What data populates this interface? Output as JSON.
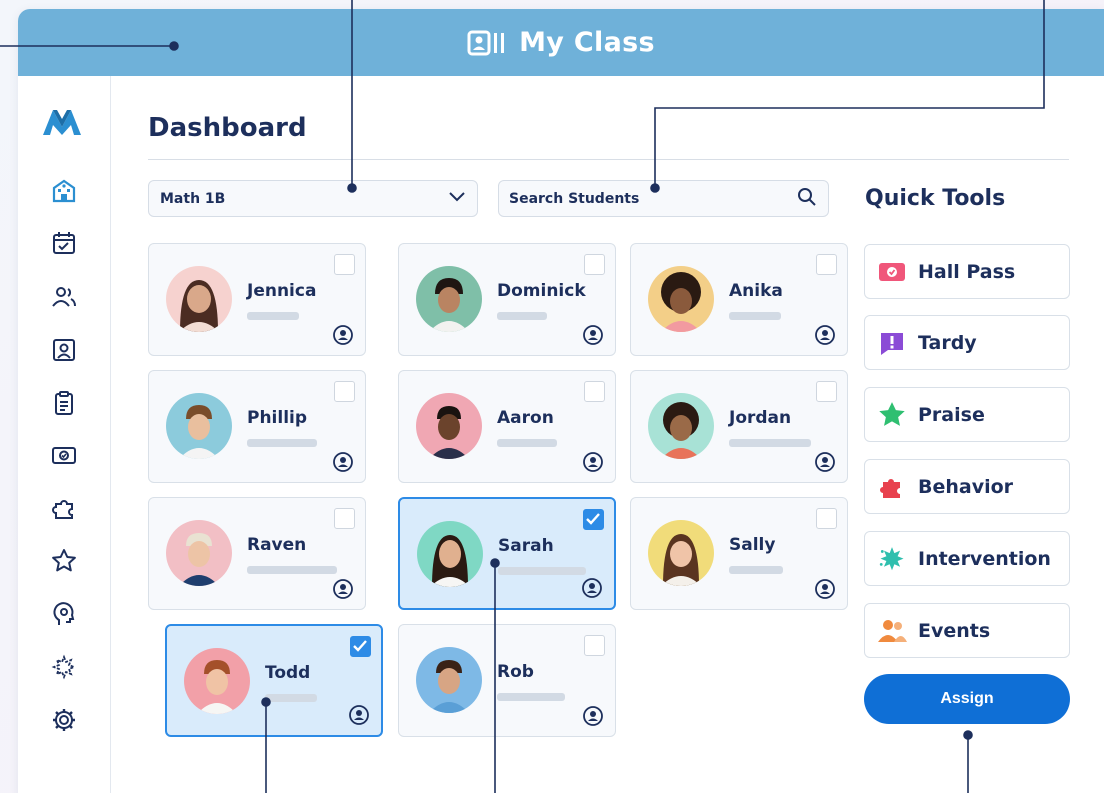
{
  "window": {
    "title": "My Class"
  },
  "page": {
    "title": "Dashboard"
  },
  "class_select": {
    "value": "Math 1B"
  },
  "search": {
    "placeholder": "Search Students"
  },
  "students": [
    {
      "name": "Jennica",
      "checked": false
    },
    {
      "name": "Dominick",
      "checked": false
    },
    {
      "name": "Anika",
      "checked": false
    },
    {
      "name": "Phillip",
      "checked": false
    },
    {
      "name": "Aaron",
      "checked": false
    },
    {
      "name": "Jordan",
      "checked": false
    },
    {
      "name": "Raven",
      "checked": false
    },
    {
      "name": "Sarah",
      "checked": true
    },
    {
      "name": "Sally",
      "checked": false
    },
    {
      "name": "Todd",
      "checked": true
    },
    {
      "name": "Rob",
      "checked": false
    }
  ],
  "quick_tools": {
    "title": "Quick Tools",
    "items": [
      {
        "label": "Hall Pass",
        "icon": "hall-pass-icon",
        "color": "#f0567a"
      },
      {
        "label": "Tardy",
        "icon": "tardy-icon",
        "color": "#8b4bd6"
      },
      {
        "label": "Praise",
        "icon": "star-icon",
        "color": "#2fbf71"
      },
      {
        "label": "Behavior",
        "icon": "puzzle-icon",
        "color": "#e8414e"
      },
      {
        "label": "Intervention",
        "icon": "burst-icon",
        "color": "#2fbfae"
      },
      {
        "label": "Events",
        "icon": "group-icon",
        "color": "#f08a3e"
      }
    ],
    "assign_label": "Assign"
  },
  "colors": {
    "header": "#6fb1d9",
    "accent": "#0f6fd6",
    "selected_border": "#2d8be6",
    "text": "#1d2f5c"
  }
}
